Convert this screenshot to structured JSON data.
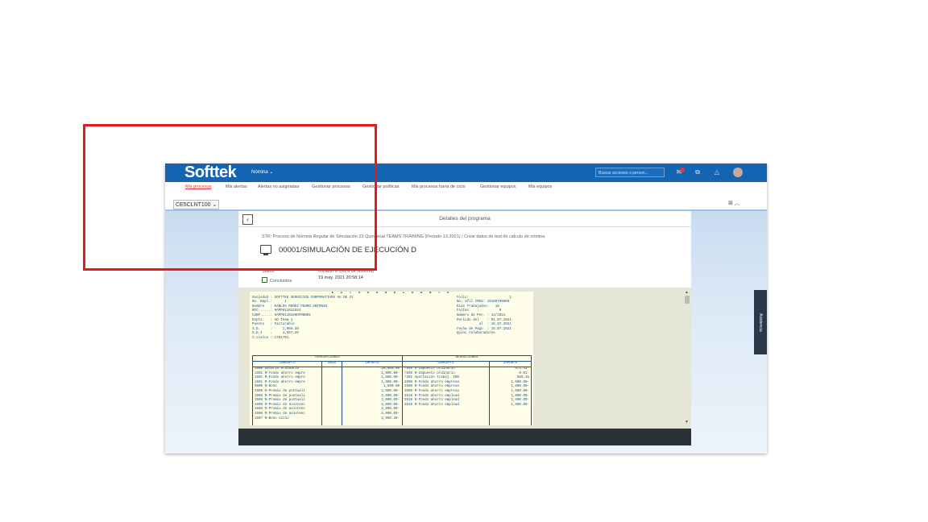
{
  "header": {
    "logo": "Softtek",
    "app_menu": "Nómina ⌄",
    "search_placeholder": "Buscar acciones o person…",
    "notification_icon": "bell-icon",
    "user_icon": "avatar"
  },
  "tabs": [
    {
      "label": "Mis procesos",
      "active": true
    },
    {
      "label": "Mis alertas"
    },
    {
      "label": "Alertas no asignadas"
    },
    {
      "label": "Gestionar procesos"
    },
    {
      "label": "Gestionar políticas"
    },
    {
      "label": "Mis procesos fuera de ciclo"
    },
    {
      "label": "Gestionar equipos"
    },
    {
      "label": "Mis equipos"
    }
  ],
  "client_selector": "CE5CLNT100 ⌄",
  "panel": {
    "title": "Detalles del programa",
    "breadcrumb": "STK: Proceso de Nómina Regular de Simulación 23 Quincenal TEAMS TRAINING (Periodo 13.2021)   /   Crear datos de test de cálculo de nómina",
    "job_title": "00001/SIMULACIÓN DE EJECUCIÓN D",
    "status_label": "Status",
    "status_value": "Concluidos",
    "start_label": "Iniciado el (hora de sistema)",
    "start_value": "19 may. 2021 20:58:14"
  },
  "report": {
    "heading": "E S T A D O   D E   C U E N T A",
    "left_lines": [
      "Sociedad : SOFTTEK SERVICIOS CORPORATIVOS SA DE CV",
      "No. Empl.:      1",
      "Nombre   : KARLOS PEREZ PEDRO ANTONIO",
      "RFC......: HAPP8110115S4",
      "CURP.....: HAPP811015HDFRNN01",
      "Depto.   : AD Team 1",
      "Puesto   : Facturable",
      "S.D.     :     1,066.39",
      "S.D.I    :     1,567.28",
      "C.costos : 1781701"
    ],
    "right_lines": [
      "Folio:                    1",
      "No. Afil IMSS: 10189798800",
      "Días Trabajados:   15",
      "Faltas    :          0",
      "Número de Per. : 13/2021",
      "Período del    : 01.07.2021",
      "           al  : 15.07.2021",
      "Fecha de Pago  : 15.07.2021",
      "Quinc Colaboradores"
    ],
    "perc_title": "PERCEPCIONES",
    "ded_title": "DEDUCCIONES",
    "col_concepto": "CONCEPTO",
    "col_unid": "UNID",
    "col_importe": "IMPORTE",
    "perc_rows": [
      {
        "c": "1000 Salario Ordinario",
        "v": "20,000.00"
      },
      {
        "c": "1501 R-Fondo ahorro empre",
        "v": "1,600.00-"
      },
      {
        "c": "1501 R-Fondo ahorro empre",
        "v": "1,600.00-"
      },
      {
        "c": "1501 R-Fondo ahorro empre",
        "v": "1,600.00-"
      },
      {
        "c": "9600 R-Bono",
        "v": "1,500.00"
      },
      {
        "c": "1506 R-Premio de puntuali",
        "v": "2,000.00-"
      },
      {
        "c": "1506 R-Premio de puntuali",
        "v": "2,000.00-"
      },
      {
        "c": "1506 R-Premio de puntuali",
        "v": "2,000.00-"
      },
      {
        "c": "1506 R-Premio de asistenc",
        "v": "2,000.00-"
      },
      {
        "c": "1506 R-Premio de asistenc",
        "v": "2,000.00-"
      },
      {
        "c": "1506 R-Premio de asistenc",
        "v": "2,000.00-"
      },
      {
        "c": "1507 R-Bono sitio",
        "v": "2,960.28-"
      }
    ],
    "ded_rows": [
      {
        "c": "/840 R-Impuesto ordinario",
        "v": "573.42-"
      },
      {
        "c": "/840 R-Impuesto ordinario",
        "v": "0.01-"
      },
      {
        "c": "/391 Aportación trabaj. IMS",
        "v": "565.45"
      },
      {
        "c": "2600 R-Fondo ahorro empresa",
        "v": "1,600.00-"
      },
      {
        "c": "2600 R-Fondo ahorro empresa",
        "v": "1,600.00-"
      },
      {
        "c": "2600 R-Fondo ahorro empresa",
        "v": "1,600.00-"
      },
      {
        "c": "2610 R-Fondo ahorro emplead",
        "v": "1,600.00-"
      },
      {
        "c": "2610 R-Fondo ahorro emplead",
        "v": "1,600.00-"
      },
      {
        "c": "2610 R-Fondo ahorro emplead",
        "v": "1,600.00-"
      }
    ]
  },
  "side_tab": "Asistencia",
  "highlight_color": "#e31b1b",
  "brand_color": "#1464b4"
}
